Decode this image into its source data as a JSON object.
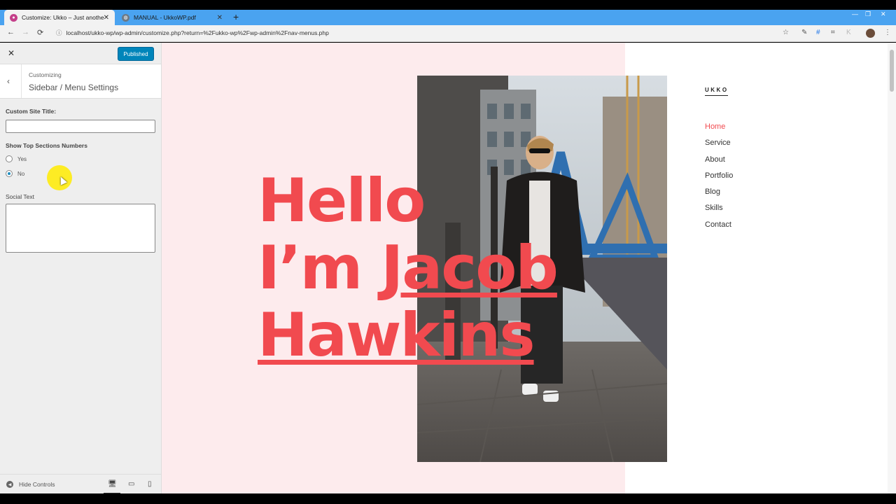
{
  "browser": {
    "tabs": [
      {
        "title": "Customize: Ukko – Just another V",
        "active": true,
        "favicon": "ukko-favicon-icon"
      },
      {
        "title": "MANUAL - UkkoWP.pdf",
        "active": false,
        "favicon": "globe-icon"
      }
    ],
    "close_glyph": "✕",
    "new_tab_glyph": "+",
    "url": "localhost/ukko-wp/wp-admin/customize.php?return=%2Fukko-wp%2Fwp-admin%2Fnav-menus.php",
    "nav_glyphs": {
      "back": "←",
      "forward": "→",
      "reload": "⟳",
      "info": "ⓘ"
    },
    "window_glyphs": {
      "minimize": "—",
      "restore": "❐",
      "close": "✕"
    },
    "ext_glyphs": {
      "star": "☆",
      "pen": "✎",
      "hash": "#",
      "crop": "⌗",
      "k": "K",
      "menu": "⋮"
    }
  },
  "customizer": {
    "close_glyph": "✕",
    "publish_label": "Published",
    "back_glyph": "‹",
    "customizing_label": "Customizing",
    "section_title": "Sidebar / Menu Settings",
    "custom_site_title_label": "Custom Site Title:",
    "custom_site_title_value": "",
    "show_numbers_label": "Show Top Sections Numbers",
    "radio_yes": "Yes",
    "radio_no": "No",
    "selected_option": "No",
    "social_text_label": "Social Text",
    "social_text_value": "",
    "hide_controls_label": "Hide Controls",
    "hide_controls_glyph": "◀",
    "device_glyphs": {
      "desktop": "🖥",
      "tablet": "▭",
      "mobile": "▯"
    }
  },
  "preview": {
    "hero_line1": "Hello",
    "hero_line2_prefix": "I’m ",
    "hero_line2_name": "Jacob",
    "hero_line3": "Hawkins",
    "logo": "UKKO",
    "nav": [
      "Home",
      "Service",
      "About",
      "Portfolio",
      "Blog",
      "Skills",
      "Contact"
    ],
    "active_nav": "Home"
  },
  "colors": {
    "accent": "#f14a4f",
    "pink_panel": "#fdebed",
    "publish_button": "#0085ba",
    "tab_strip": "#4aa3f0"
  }
}
